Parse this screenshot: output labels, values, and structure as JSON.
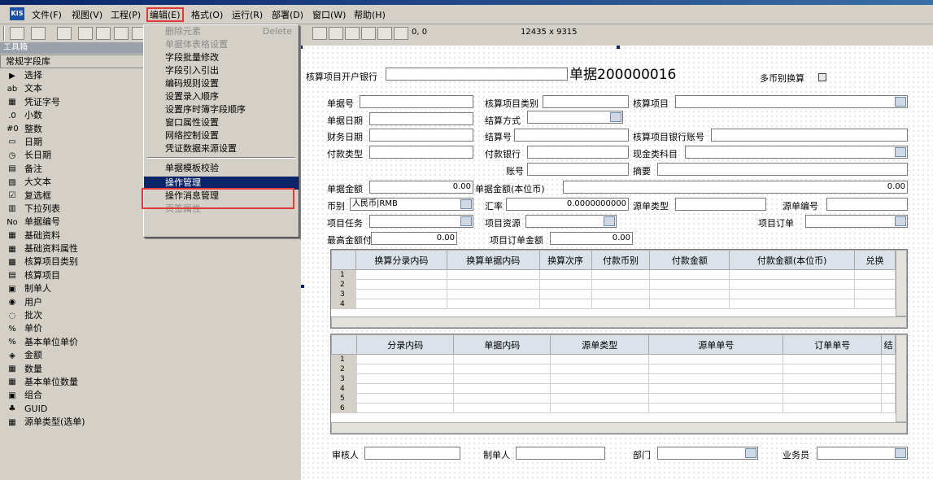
{
  "titlebar": {
    "text": ""
  },
  "menu": {
    "logo": "KIS",
    "items": [
      "文件(F)",
      "视图(V)",
      "工程(P)",
      "编辑(E)",
      "格式(O)",
      "运行(R)",
      "部署(D)",
      "窗口(W)",
      "帮助(H)"
    ]
  },
  "toolbar": {
    "coords": "0, 0",
    "size_text": "12435 x 9315"
  },
  "toolbox": {
    "title": "工具箱",
    "group": "常规字段库",
    "items": [
      {
        "icon": "▶",
        "label": "选择"
      },
      {
        "icon": "ab",
        "label": "文本"
      },
      {
        "icon": "▦",
        "label": "凭证字号"
      },
      {
        "icon": ".0",
        "label": "小数"
      },
      {
        "icon": "#0",
        "label": "整数"
      },
      {
        "icon": "▭",
        "label": "日期"
      },
      {
        "icon": "◷",
        "label": "长日期"
      },
      {
        "icon": "▤",
        "label": "备注"
      },
      {
        "icon": "▧",
        "label": "大文本"
      },
      {
        "icon": "☑",
        "label": "复选框"
      },
      {
        "icon": "▥",
        "label": "下拉列表"
      },
      {
        "icon": "No",
        "label": "单据编号"
      },
      {
        "icon": "▦",
        "label": "基础资料"
      },
      {
        "icon": "▦",
        "label": "基础资料属性"
      },
      {
        "icon": "▩",
        "label": "核算项目类别"
      },
      {
        "icon": "▤",
        "label": "核算项目"
      },
      {
        "icon": "▣",
        "label": "制单人"
      },
      {
        "icon": "◉",
        "label": "用户"
      },
      {
        "icon": "◌",
        "label": "批次"
      },
      {
        "icon": "%",
        "label": "单价"
      },
      {
        "icon": "%",
        "label": "基本单位单价"
      },
      {
        "icon": "◈",
        "label": "金额"
      },
      {
        "icon": "▦",
        "label": "数量"
      },
      {
        "icon": "▦",
        "label": "基本单位数量"
      },
      {
        "icon": "▣",
        "label": "组合"
      },
      {
        "icon": "♣",
        "label": "GUID"
      },
      {
        "icon": "▦",
        "label": "源单类型(选单)"
      }
    ]
  },
  "edit_menu": {
    "items": [
      {
        "label": "删除元素",
        "shortcut": "Delete",
        "disabled": true
      },
      {
        "label": "单据体表格设置",
        "shortcut": "",
        "disabled": true
      },
      {
        "label": "字段批量修改",
        "shortcut": "",
        "disabled": false
      },
      {
        "label": "字段引入引出",
        "shortcut": "",
        "disabled": false
      },
      {
        "label": "编码规则设置",
        "shortcut": "",
        "disabled": false
      },
      {
        "label": "设置录入顺序",
        "shortcut": "",
        "disabled": false
      },
      {
        "label": "设置序时簿字段顺序",
        "shortcut": "",
        "disabled": false
      },
      {
        "label": "窗口属性设置",
        "shortcut": "",
        "disabled": false
      },
      {
        "label": "网络控制设置",
        "shortcut": "",
        "disabled": false
      },
      {
        "label": "凭证数据来源设置",
        "shortcut": "",
        "disabled": false
      },
      {
        "label": "单据模板校验",
        "shortcut": "",
        "disabled": false
      },
      {
        "label": "操作管理",
        "shortcut": "",
        "disabled": false
      },
      {
        "label": "操作消息管理",
        "shortcut": "",
        "disabled": false
      },
      {
        "label": "页签属性",
        "shortcut": "",
        "disabled": true
      }
    ]
  },
  "form": {
    "title": "单据200000016",
    "bank_label": "核算项目开户银行",
    "multi_currency_label": "多币别换算",
    "labels": {
      "bill_no": "单据号",
      "item_type": "核算项目类别",
      "item": "核算项目",
      "bill_date": "单据日期",
      "settle_method": "结算方式",
      "finance_date": "财务日期",
      "settle_no": "结算号",
      "item_bank_acct": "核算项目银行账号",
      "pay_type": "付款类型",
      "pay_bank": "付款银行",
      "cash_subject": "现金类科目",
      "account": "账号",
      "summary": "摘要",
      "bill_amount": "单据金额",
      "bill_amount_local": "单据金额(本位币)",
      "currency": "币别",
      "rate": "汇率",
      "source_type": "源单类型",
      "source_no": "源单编号",
      "project_task": "项目任务",
      "project_resource": "项目资源",
      "project_order": "项目订单",
      "max_pay": "最高金额付款",
      "order_amount": "项目订单金额",
      "reviewer": "审核人",
      "maker": "制单人",
      "dept": "部门",
      "salesman": "业务员"
    },
    "values": {
      "bill_amount": "0.00",
      "bill_amount_local": "0.00",
      "currency": "人民币|RMB",
      "rate": "0.0000000000",
      "max_pay": "0.00",
      "order_amount": "0.00"
    }
  },
  "grid1": {
    "columns": [
      "换算分录内码",
      "换算单据内码",
      "换算次序",
      "付款币别",
      "付款金额",
      "付款金额(本位币)",
      "兑换"
    ],
    "rows": [
      "1",
      "2",
      "3",
      "4"
    ]
  },
  "grid2": {
    "columns": [
      "分录内码",
      "单据内码",
      "源单类型",
      "源单单号",
      "订单单号",
      "结"
    ],
    "rows": [
      "1",
      "2",
      "3",
      "4",
      "5",
      "6"
    ]
  }
}
